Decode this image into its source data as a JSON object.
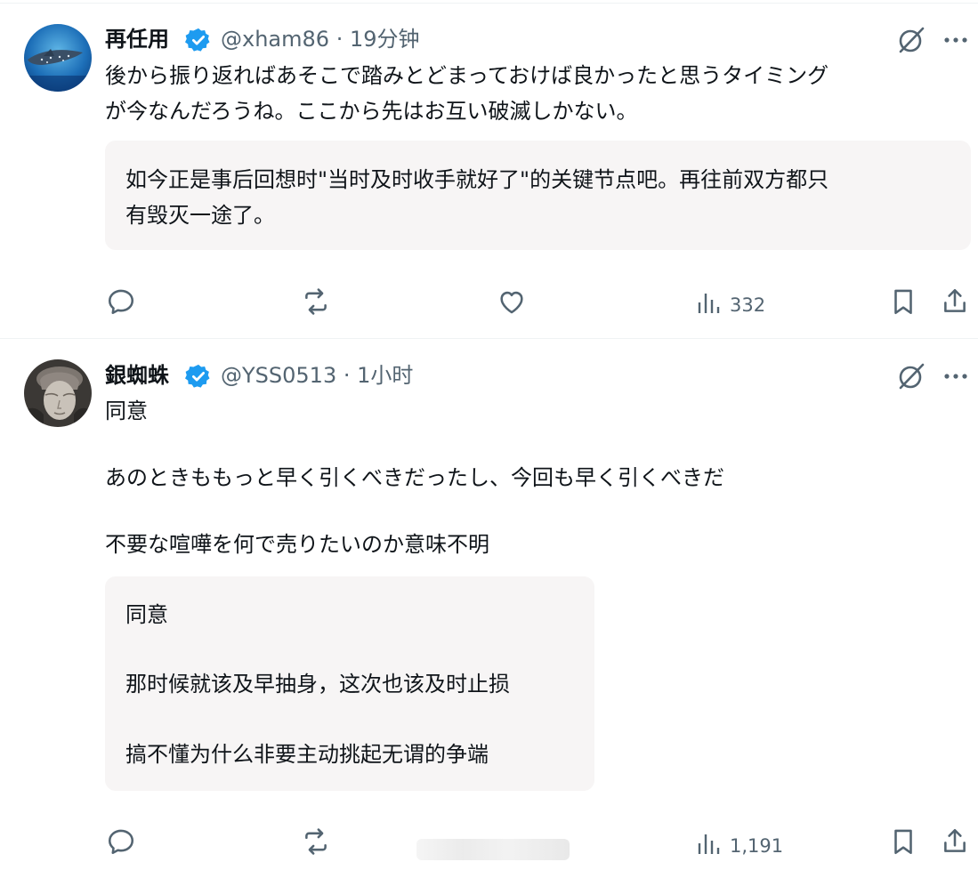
{
  "colors": {
    "verified": "#1d9bf0",
    "secondary_text": "#536471",
    "translation_bg": "#f7f5f5",
    "divider": "#eff3f4"
  },
  "posts": [
    {
      "author": {
        "display_name": "再任用",
        "handle": "@xham86",
        "separator": "·",
        "time": "19分钟"
      },
      "text_lines": [
        "後から振り返ればあそこで踏みとどまっておけば良かったと思うタイミング",
        "が今なんだろうね。ここから先はお互い破滅しかない。"
      ],
      "translation_lines": [
        "如今正是事后回想时\"当时及时收手就好了\"的关键节点吧。再往前双方都只",
        "有毁灭一途了。"
      ],
      "stats": {
        "views": "332"
      },
      "icons": [
        "reply-icon",
        "repost-icon",
        "like-icon",
        "views-icon",
        "bookmark-icon",
        "share-icon",
        "grok-icon",
        "more-icon"
      ]
    },
    {
      "author": {
        "display_name": "銀蜘蛛",
        "handle": "@YSS0513",
        "separator": "·",
        "time": "1小时"
      },
      "text_lines": [
        "同意",
        "あのときももっと早く引くべきだったし、今回も早く引くべきだ",
        "不要な喧嘩を何で売りたいのか意味不明"
      ],
      "translation_lines": [
        "同意",
        "那时候就该及早抽身，这次也该及时止损",
        "搞不懂为什么非要主动挑起无谓的争端"
      ],
      "stats": {
        "views": "1,191"
      },
      "icons": [
        "reply-icon",
        "repost-icon",
        "views-icon",
        "bookmark-icon",
        "share-icon",
        "grok-icon",
        "more-icon"
      ]
    }
  ]
}
